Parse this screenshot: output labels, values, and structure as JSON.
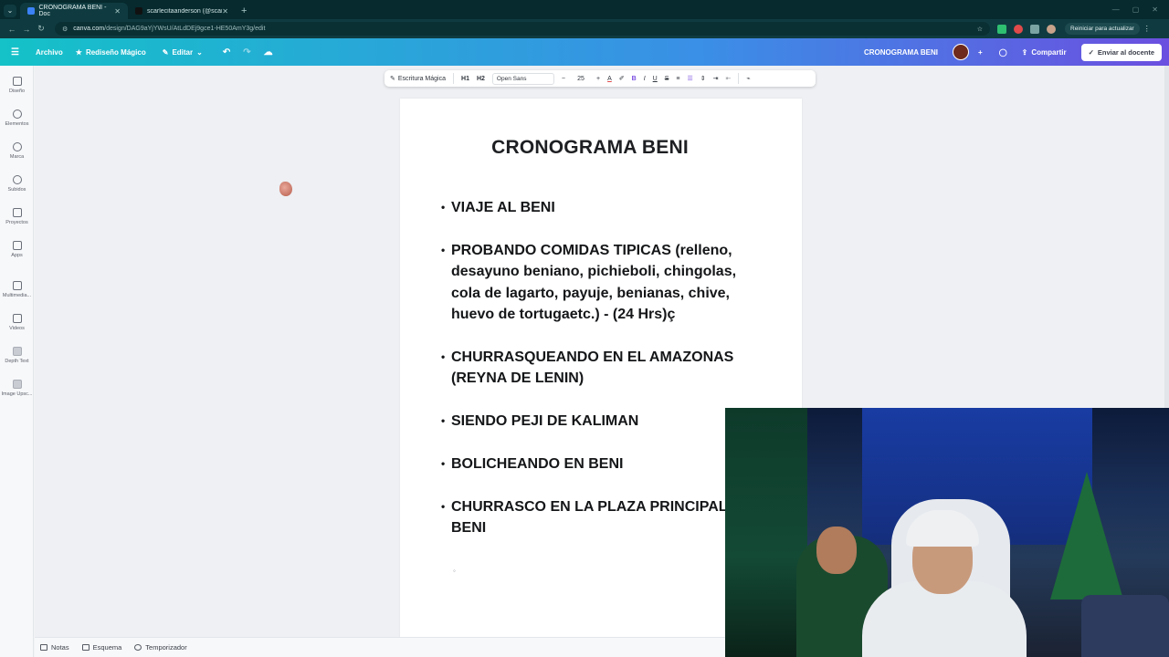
{
  "browser": {
    "tabs": [
      {
        "label": "CRONOGRAMA BENI - Doc",
        "active": true,
        "favicon_color": "#3b82f6"
      },
      {
        "label": "scarlecitaanderson (@scarlehta",
        "active": false,
        "favicon_color": "#111111"
      }
    ],
    "url_host": "canva.com",
    "url_path": "/design/DAG9aYjYWsU/AtLdDEj9gce1-HE50AmY3g/edit",
    "reiniciar_label": "Reiniciar para actualizar"
  },
  "canva_header": {
    "archivo": "Archivo",
    "rediseno": "Rediseño Mágico",
    "editar": "Editar",
    "doc_title": "CRONOGRAMA BENI",
    "compartir": "Compartir",
    "enviar": "Enviar al docente"
  },
  "sidebar": {
    "items": [
      {
        "label": "Diseño",
        "icon": "layout-icon"
      },
      {
        "label": "Elementos",
        "icon": "shapes-icon"
      },
      {
        "label": "Marca",
        "icon": "brand-icon"
      },
      {
        "label": "Subidos",
        "icon": "upload-cloud-icon"
      },
      {
        "label": "Proyectos",
        "icon": "folder-icon"
      },
      {
        "label": "Apps",
        "icon": "apps-icon"
      },
      {
        "label": "Multimedia...",
        "icon": "multimedia-icon"
      },
      {
        "label": "Videos",
        "icon": "video-icon"
      },
      {
        "label": "Depth Text",
        "icon": "depth-text-icon"
      },
      {
        "label": "Image Upsc...",
        "icon": "image-upscale-icon"
      }
    ]
  },
  "text_toolbar": {
    "magic_write": "Escritura Mágica",
    "h1": "H1",
    "h2": "H2",
    "font": "Open Sans",
    "size": "25",
    "bold": "B",
    "italic": "I",
    "underline": "U",
    "strike": "S"
  },
  "document": {
    "heading": "CRONOGRAMA BENI",
    "bullets": [
      "VIAJE AL BENI",
      "PROBANDO COMIDAS TIPICAS (relleno, desayuno beniano, pichieboli, chingolas, cola de lagarto, payuje, benianas, chive, huevo de tortugaetc.) - (24 Hrs)ç",
      "CHURRASQUEANDO EN EL AMAZONAS (REYNA DE LENIN)",
      "SIENDO PEJI DE KALIMAN",
      "BOLICHEANDO EN BENI",
      "CHURRASCO EN LA PLAZA PRINCIPAL DE BENI"
    ],
    "empty_sub_bullet": "◦"
  },
  "bottom_bar": {
    "notas": "Notas",
    "esquema": "Esquema",
    "temporizador": "Temporizador"
  },
  "colors": {
    "header_start": "#14c2c8",
    "header_end": "#6b4fe0",
    "browser_dark": "#062a2e"
  }
}
